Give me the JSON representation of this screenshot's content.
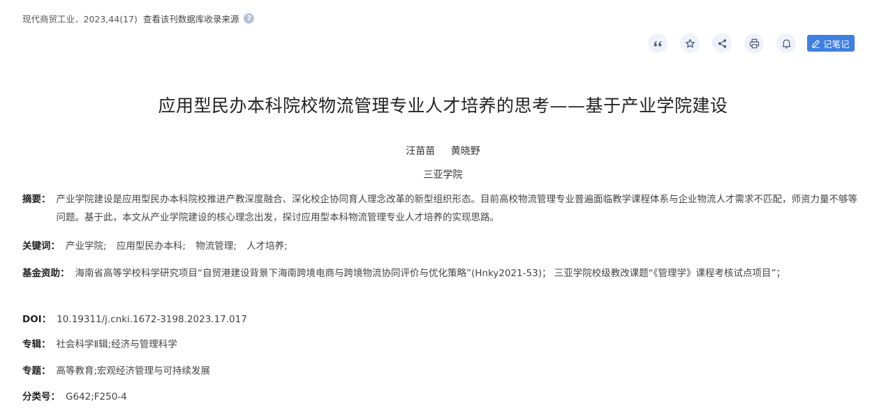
{
  "source": {
    "journal": "现代商贸工业．2023,44(17)",
    "db_link": "查看该刊数据库收录来源"
  },
  "toolbar": {
    "buttons": [
      "quote-icon",
      "star-icon",
      "share-icon",
      "print-icon",
      "bell-icon"
    ],
    "note_label": "记笔记",
    "accent_color": "#3f7fe0"
  },
  "title": "应用型民办本科院校物流管理专业人才培养的思考——基于产业学院建设",
  "authors": [
    "汪苗苗",
    "黄晓野"
  ],
  "organization": "三亚学院",
  "abstract": {
    "label": "摘要：",
    "text": "产业学院建设是应用型民办本科院校推进产教深度融合、深化校企协同育人理念改革的新型组织形态。目前高校物流管理专业普遍面临教学课程体系与企业物流人才需求不匹配，师资力量不够等问题。基于此，本文从产业学院建设的核心理念出发，探讨应用型本科物流管理专业人才培养的实现思路。"
  },
  "keywords": {
    "label": "关键词：",
    "items": [
      "产业学院;",
      "应用型民办本科;",
      "物流管理;",
      "人才培养;"
    ]
  },
  "funding": {
    "label": "基金资助：",
    "text": "海南省高等学校科学研究项目“自贸港建设背景下海南跨境电商与跨境物流协同评价与优化策略”(Hnky2021-53)； 三亚学院校级教改课题“《管理学》课程考核试点项目”；"
  },
  "doi": {
    "label": "DOI：",
    "value": "10.19311/j.cnki.1672-3198.2023.17.017"
  },
  "series": {
    "label": "专辑：",
    "value": "社会科学Ⅱ辑;经济与管理科学"
  },
  "topic": {
    "label": "专题：",
    "value": "高等教育;宏观经济管理与可持续发展"
  },
  "classification": {
    "label": "分类号：",
    "value": "G642;F250-4"
  }
}
